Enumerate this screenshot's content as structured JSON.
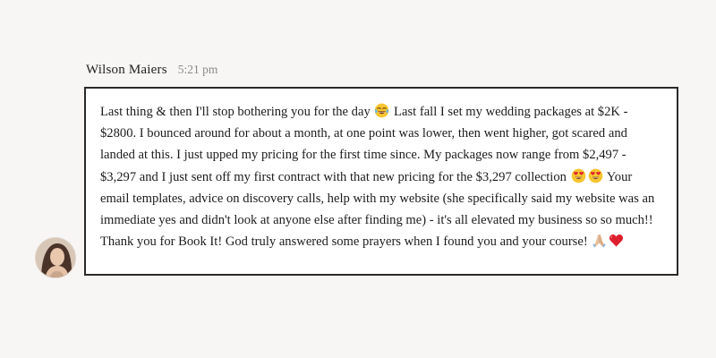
{
  "message": {
    "author": "Wilson Maiers",
    "timestamp": "5:21 pm",
    "avatar_icon": "user-avatar-photo",
    "segments": [
      "Last thing & then I'll stop bothering you for the day ",
      " Last fall I set my wedding packages at $2K - $2800. I bounced around for about a month, at one point was lower, then went higher, got scared and landed at this. I just upped my pricing for the first time since. My packages now range from $2,497 - $3,297 and I just sent off my first contract with that new pricing for the $3,297 collection ",
      " Your email templates, advice on discovery calls, help with my website (she specifically said my website was an immediate yes and didn't look at anyone else after finding me) - it's all elevated my business so so much!! Thank you for Book It! God truly answered some prayers when I found you and your course! "
    ],
    "emojis": {
      "laughing": "face-with-tears-of-joy-emoji",
      "heart_eyes": "smiling-face-with-heart-eyes-emoji",
      "folded_hands": "folded-hands-emoji",
      "heart": "red-heart-emoji"
    }
  },
  "colors": {
    "background": "#f8f6f4",
    "bubble_border": "#2a2a2a",
    "bubble_background": "#ffffff",
    "timestamp": "#8b8b8b"
  }
}
